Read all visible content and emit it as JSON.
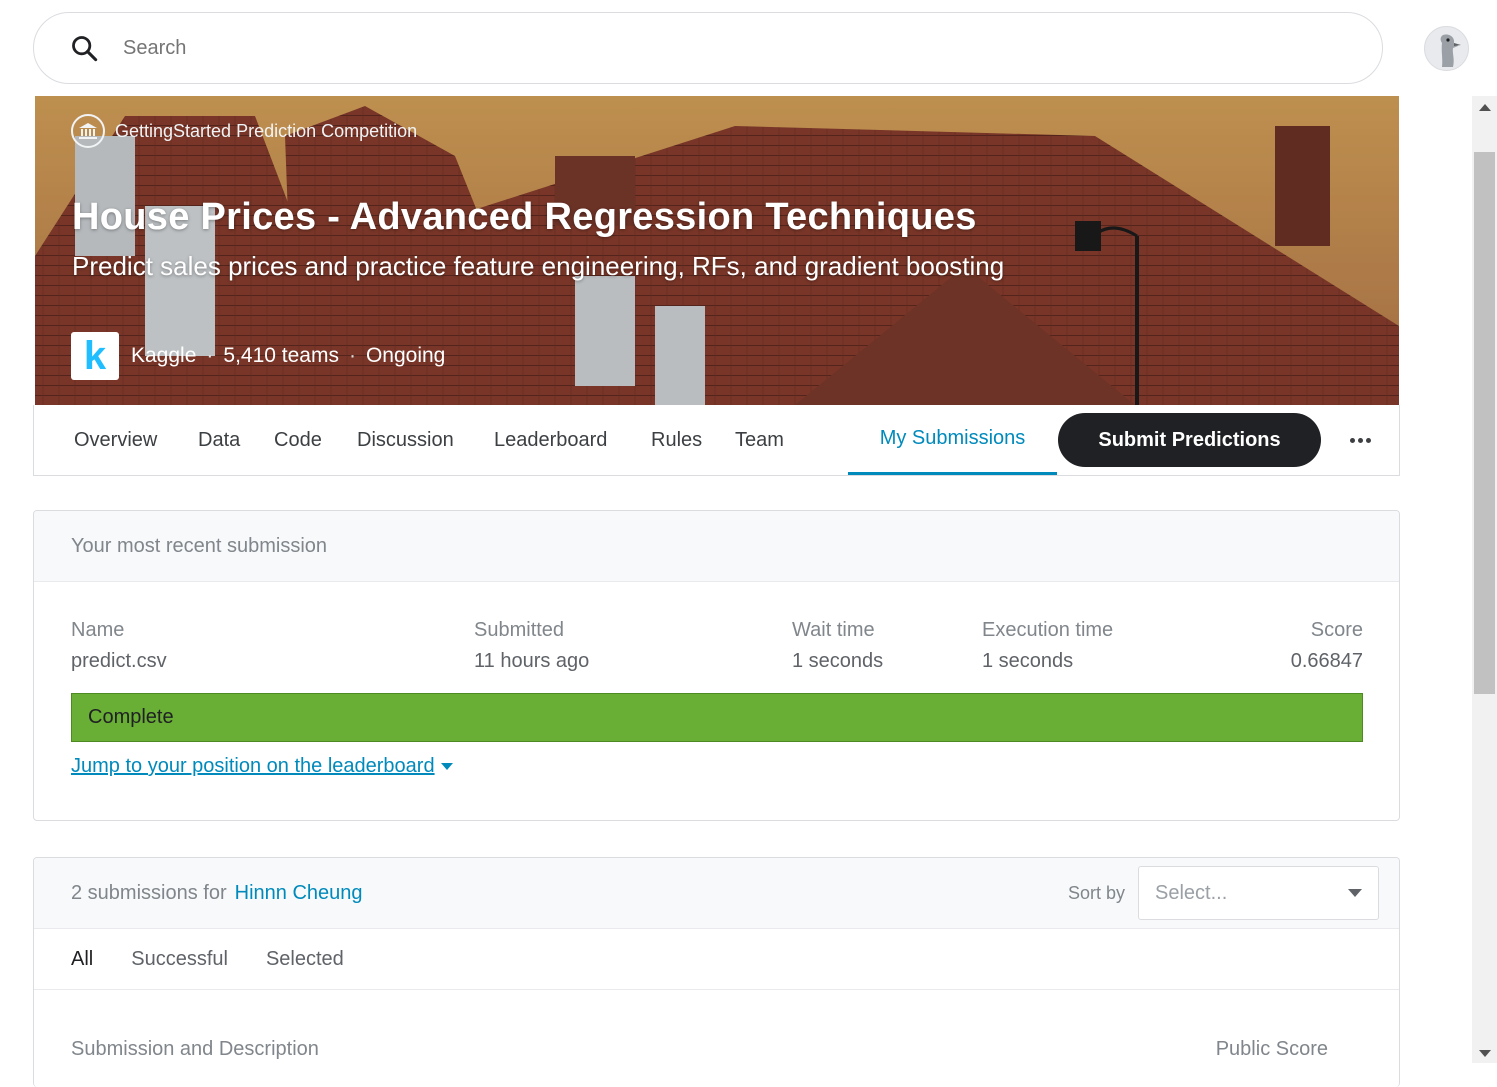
{
  "search": {
    "placeholder": "Search"
  },
  "hero": {
    "competition_type": "GettingStarted Prediction Competition",
    "title": "House Prices - Advanced Regression Techniques",
    "subtitle": "Predict sales prices and practice feature engineering, RFs, and gradient boosting",
    "logo_letter": "k",
    "host": "Kaggle",
    "teams": "5,410 teams",
    "status": "Ongoing",
    "separator": "·"
  },
  "tabs": {
    "items": [
      "Overview",
      "Data",
      "Code",
      "Discussion",
      "Leaderboard",
      "Rules",
      "Team"
    ],
    "my_submissions": "My Submissions",
    "submit_label": "Submit Predictions"
  },
  "recent": {
    "header": "Your most recent submission",
    "columns": [
      {
        "label": "Name",
        "value": "predict.csv"
      },
      {
        "label": "Submitted",
        "value": "11 hours ago"
      },
      {
        "label": "Wait time",
        "value": "1 seconds"
      },
      {
        "label": "Execution time",
        "value": "1 seconds"
      },
      {
        "label": "Score",
        "value": "0.66847"
      }
    ],
    "status": "Complete",
    "status_color": "#6aaf35",
    "jump_link": "Jump to your position on the leaderboard"
  },
  "submissions": {
    "count_text": "2 submissions for",
    "user": "Hinnn Cheung",
    "sort_label": "Sort by",
    "sort_placeholder": "Select...",
    "filters": [
      "All",
      "Successful",
      "Selected"
    ],
    "col_description": "Submission and Description",
    "col_public_score": "Public Score"
  },
  "colors": {
    "accent": "#008abc",
    "dark_button": "#202124"
  }
}
